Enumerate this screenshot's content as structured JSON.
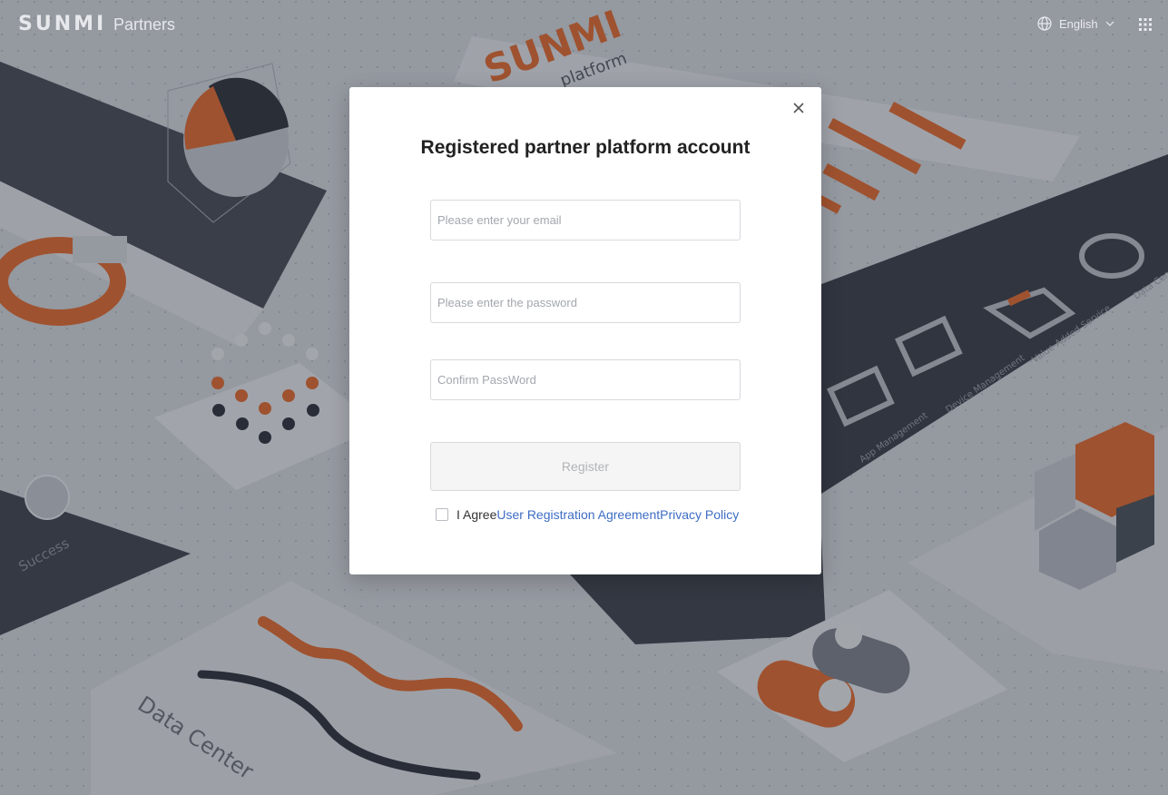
{
  "header": {
    "logo_text": "SUNMI",
    "logo_sub": "Partners",
    "language": "English",
    "icons": [
      "globe-icon",
      "chevron-down-icon",
      "apps-grid-icon"
    ]
  },
  "background": {
    "labels": [
      "platform",
      "App Management",
      "Device Management",
      "Value-Added Service",
      "Data Center",
      "Success",
      "Data Center"
    ],
    "colors": {
      "accent": "#e8692a",
      "dark": "#2f3440",
      "light": "#dfe2e7"
    }
  },
  "modal": {
    "title": "Registered partner platform account",
    "email_placeholder": "Please enter your email",
    "password_placeholder": "Please enter the password",
    "confirm_placeholder": "Confirm PassWord",
    "register_label": "Register",
    "agree_prefix": "I Agree",
    "agreement_link": "User Registration Agreement",
    "privacy_link": "Privacy Policy",
    "close_icon": "close-icon"
  }
}
